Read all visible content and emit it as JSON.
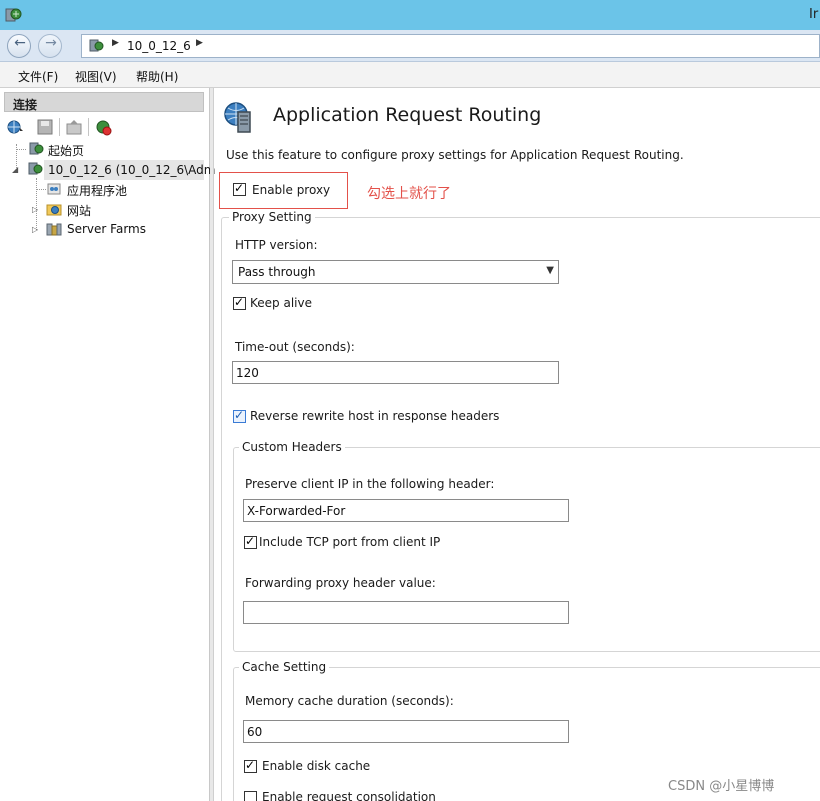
{
  "window": {
    "title_partial": "Ir"
  },
  "address_bar": {
    "crumb": "10_0_12_6"
  },
  "menu": {
    "items": [
      {
        "label": "文件(F)"
      },
      {
        "label": "视图(V)"
      },
      {
        "label": "帮助(H)"
      }
    ]
  },
  "connections": {
    "header": "连接",
    "tree": [
      {
        "label": "起始页"
      },
      {
        "label": "10_0_12_6 (10_0_12_6\\Adm"
      },
      {
        "label": "应用程序池"
      },
      {
        "label": "网站"
      },
      {
        "label": "Server Farms"
      }
    ]
  },
  "main": {
    "title": "Application Request Routing",
    "description": "Use this feature to configure proxy settings for Application Request Routing.",
    "enable_proxy": {
      "label": "Enable proxy",
      "checked": true
    },
    "annotation": "勾选上就行了",
    "proxy_setting": {
      "title": "Proxy Setting",
      "http_version_label": "HTTP version:",
      "http_version_value": "Pass through",
      "keep_alive": {
        "label": "Keep alive",
        "checked": true
      },
      "timeout_label": "Time-out (seconds):",
      "timeout_value": "120",
      "reverse_rewrite": {
        "label": "Reverse rewrite host in response headers",
        "checked": true
      }
    },
    "custom_headers": {
      "title": "Custom Headers",
      "preserve_ip_label": "Preserve client IP in the following header:",
      "preserve_ip_value": "X-Forwarded-For",
      "include_tcp_port": {
        "label": "Include TCP port from client IP",
        "checked": true
      },
      "forwarding_label": "Forwarding proxy header value:",
      "forwarding_value": ""
    },
    "cache_setting": {
      "title": "Cache Setting",
      "memory_cache_label": "Memory cache duration (seconds):",
      "memory_cache_value": "60",
      "enable_disk_cache": {
        "label": "Enable disk cache",
        "checked": true
      },
      "enable_request_consolidation": {
        "label": "Enable request consolidation",
        "checked": false
      }
    }
  },
  "watermark": "CSDN @小星博博",
  "colors": {
    "titlebar": "#6bc4e8",
    "annotation": "#e3514a"
  }
}
